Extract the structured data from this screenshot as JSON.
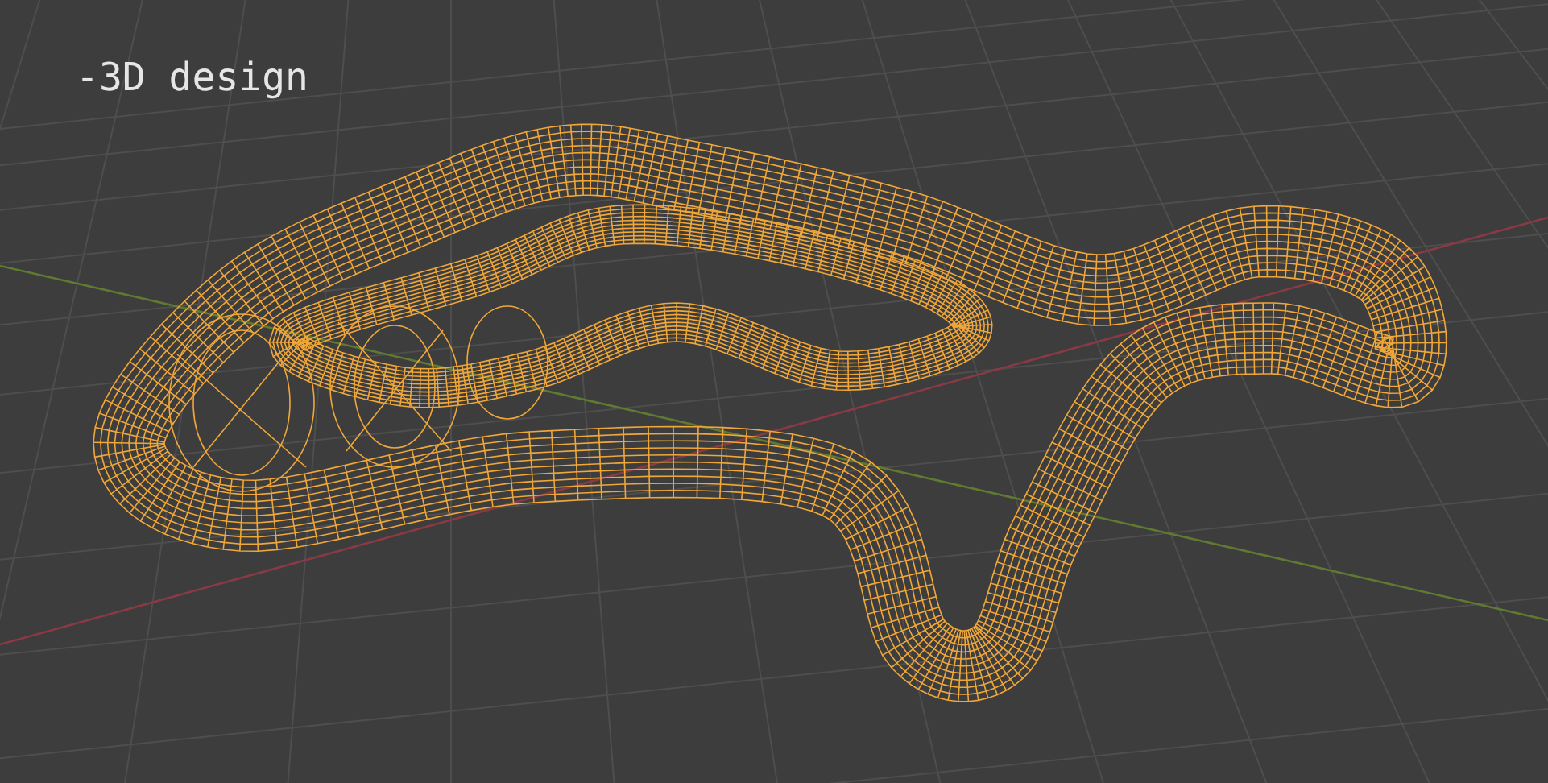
{
  "viewport": {
    "title": "-3D design"
  }
}
